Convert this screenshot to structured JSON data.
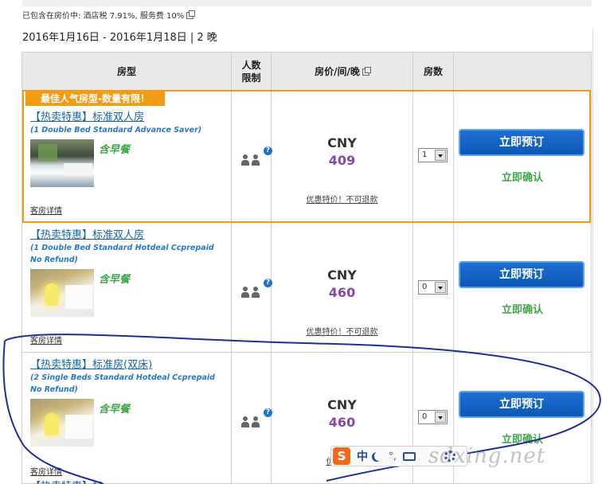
{
  "tax_note": "已包含在房价中: 酒店税 7.91%, 服务费 10%",
  "stay": "2016年1月16日 - 2016年1月18日 | 2 晚",
  "headers": {
    "room_type": "房型",
    "occupancy": "人数限制",
    "price": "房价/间/晚",
    "rooms": "房数"
  },
  "ribbon": "最佳人气房型-数量有限！",
  "rooms": [
    {
      "name": "【热卖特惠】标准双人房",
      "name_en": "(1 Double Bed Standard Advance Saver)",
      "breakfast": "含早餐",
      "details": "客房详情",
      "currency": "CNY",
      "price": "409",
      "policy": "优惠特价！不可退款",
      "qty": "1",
      "book": "立即预订",
      "confirm": "立即确认"
    },
    {
      "name": "【热卖特惠】标准双人房",
      "name_en": "(1 Double Bed Standard Hotdeal Ccprepaid No Refund)",
      "breakfast": "含早餐",
      "details": "客房详情",
      "currency": "CNY",
      "price": "460",
      "policy": "优惠特价！不可退款",
      "qty": "0",
      "book": "立即预订",
      "confirm": "立即确认"
    },
    {
      "name": "【热卖特惠】标准房(双床)",
      "name_en": "(2 Single Beds Standard Hotdeal Ccprepaid No Refund)",
      "breakfast": "含早餐",
      "details": "客房详情",
      "currency": "CNY",
      "price": "460",
      "policy": "优惠特价",
      "qty": "0",
      "book": "立即预订",
      "confirm": "立即确认"
    }
  ],
  "cut_row_text": "【热卖特惠】标",
  "ime": {
    "logo": "S",
    "lang": "中",
    "dot": "°,"
  },
  "watermark": "sdxing.net",
  "colors": {
    "accent_orange": "#f39c12",
    "link_blue": "#1565a6",
    "price_purple": "#8e44ad",
    "confirm_green": "#3fa64a",
    "book_blue": "#0d58b8"
  }
}
